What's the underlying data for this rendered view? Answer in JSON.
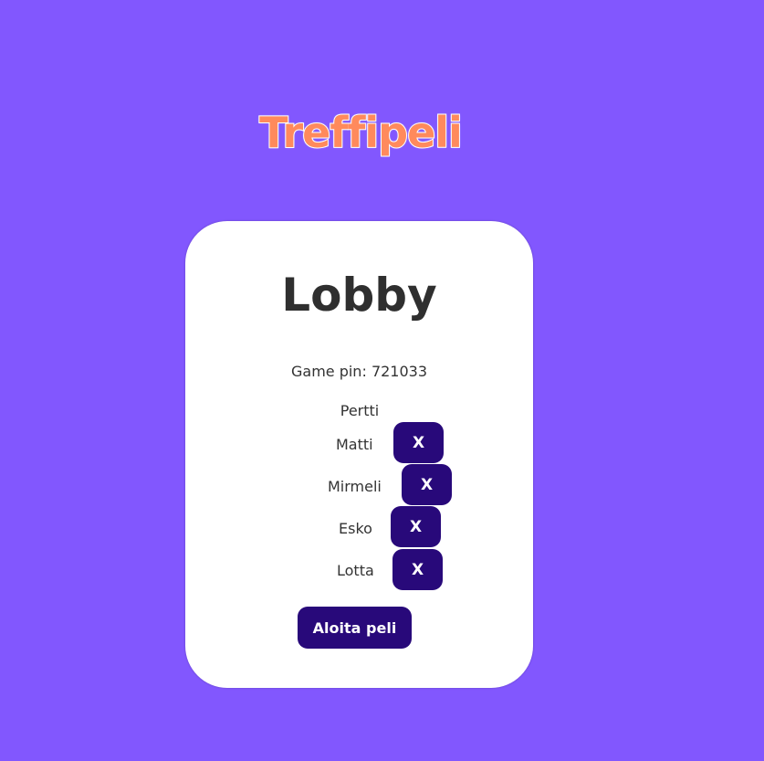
{
  "app": {
    "title": "Treffipeli"
  },
  "lobby": {
    "title": "Lobby",
    "pin_label": "Game pin:",
    "pin_value": "721033",
    "host": "Pertti",
    "players": [
      {
        "name": "Matti",
        "kick_label": "X"
      },
      {
        "name": "Mirmeli",
        "kick_label": "X"
      },
      {
        "name": "Esko",
        "kick_label": "X"
      },
      {
        "name": "Lotta",
        "kick_label": "X"
      }
    ],
    "start_label": "Aloita peli"
  },
  "colors": {
    "background": "#8257fe",
    "title_fill": "#ff8a5c",
    "title_outline": "#ffffff",
    "card": "#ffffff",
    "button": "#28097a",
    "text": "#333333"
  }
}
